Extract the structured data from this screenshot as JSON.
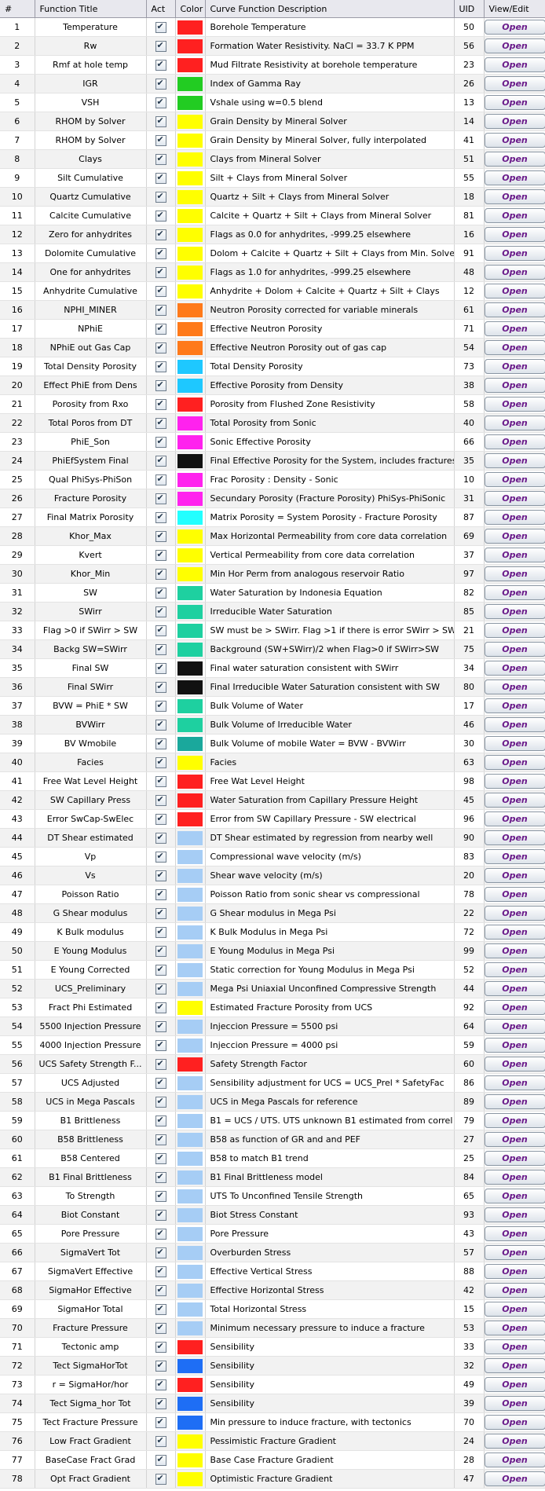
{
  "table": {
    "headers": {
      "num": "#",
      "title": "Function Title",
      "act": "Act",
      "color": "Color",
      "desc": "Curve Function Description",
      "uid": "UID",
      "view": "View/Edit"
    },
    "open_label": "Open",
    "rows": [
      {
        "num": "1",
        "title": "Temperature",
        "color": "#ff2020",
        "desc": "Borehole Temperature",
        "uid": "50"
      },
      {
        "num": "2",
        "title": "Rw",
        "color": "#ff2020",
        "desc": "Formation Water Resistivity. NaCl = 33.7 K PPM",
        "uid": "56"
      },
      {
        "num": "3",
        "title": "Rmf at hole temp",
        "color": "#ff2020",
        "desc": "Mud Filtrate Resistivity at borehole temperature",
        "uid": "23"
      },
      {
        "num": "4",
        "title": "IGR",
        "color": "#22cc22",
        "desc": "Index of Gamma Ray",
        "uid": "26"
      },
      {
        "num": "5",
        "title": "VSH",
        "color": "#22cc22",
        "desc": "Vshale using w=0.5 blend",
        "uid": "13"
      },
      {
        "num": "6",
        "title": "RHOM by Solver",
        "color": "#ffff00",
        "desc": "Grain Density by Mineral Solver",
        "uid": "14"
      },
      {
        "num": "7",
        "title": "RHOM by Solver",
        "color": "#ffff00",
        "desc": "Grain Density by Mineral Solver, fully interpolated",
        "uid": "41"
      },
      {
        "num": "8",
        "title": "Clays",
        "color": "#ffff00",
        "desc": "Clays from Mineral Solver",
        "uid": "51"
      },
      {
        "num": "9",
        "title": "Silt Cumulative",
        "color": "#ffff00",
        "desc": "Silt + Clays from Mineral Solver",
        "uid": "55"
      },
      {
        "num": "10",
        "title": "Quartz Cumulative",
        "color": "#ffff00",
        "desc": "Quartz + Silt + Clays from Mineral Solver",
        "uid": "18"
      },
      {
        "num": "11",
        "title": "Calcite Cumulative",
        "color": "#ffff00",
        "desc": "Calcite + Quartz + Silt + Clays from Mineral Solver",
        "uid": "81"
      },
      {
        "num": "12",
        "title": "Zero for anhydrites",
        "color": "#ffff00",
        "desc": "Flags as 0.0 for anhydrites, -999.25 elsewhere",
        "uid": "16"
      },
      {
        "num": "13",
        "title": "Dolomite Cumulative",
        "color": "#ffff00",
        "desc": "Dolom + Calcite + Quartz + Silt + Clays from Min. Solver",
        "uid": "91"
      },
      {
        "num": "14",
        "title": "One for anhydrites",
        "color": "#ffff00",
        "desc": "Flags as 1.0 for anhydrites, -999.25 elsewhere",
        "uid": "48"
      },
      {
        "num": "15",
        "title": "Anhydrite Cumulative",
        "color": "#ffff00",
        "desc": "Anhydrite + Dolom + Calcite + Quartz + Silt + Clays",
        "uid": "12"
      },
      {
        "num": "16",
        "title": "NPHI_MINER",
        "color": "#ff7a1a",
        "desc": "Neutron Porosity corrected for variable minerals",
        "uid": "61"
      },
      {
        "num": "17",
        "title": "NPhiE",
        "color": "#ff7a1a",
        "desc": "Effective Neutron Porosity",
        "uid": "71"
      },
      {
        "num": "18",
        "title": "NPhiE out Gas Cap",
        "color": "#ff7a1a",
        "desc": "Effective Neutron Porosity out of gas cap",
        "uid": "54"
      },
      {
        "num": "19",
        "title": "Total Density Porosity",
        "color": "#1ec8ff",
        "desc": "Total Density Porosity",
        "uid": "73"
      },
      {
        "num": "20",
        "title": "Effect PhiE from Dens",
        "color": "#1ec8ff",
        "desc": "Effective Porosity from Density",
        "uid": "38"
      },
      {
        "num": "21",
        "title": "Porosity from Rxo",
        "color": "#ff2020",
        "desc": "Porosity from Flushed Zone Resistivity",
        "uid": "58"
      },
      {
        "num": "22",
        "title": "Total Poros from DT",
        "color": "#ff22ee",
        "desc": "Total Porosity from Sonic",
        "uid": "40"
      },
      {
        "num": "23",
        "title": "PhiE_Son",
        "color": "#ff22ee",
        "desc": "Sonic Effective Porosity",
        "uid": "66"
      },
      {
        "num": "24",
        "title": "PhiEfSystem Final",
        "color": "#111111",
        "desc": "Final Effective Porosity for the System, includes fractures",
        "uid": "35"
      },
      {
        "num": "25",
        "title": "Qual PhiSys-PhiSon",
        "color": "#ff22ee",
        "desc": "Frac Porosity : Density - Sonic",
        "uid": "10"
      },
      {
        "num": "26",
        "title": "Fracture Porosity",
        "color": "#ff22ee",
        "desc": "Secundary Porosity (Fracture Porosity) PhiSys-PhiSonic",
        "uid": "31"
      },
      {
        "num": "27",
        "title": "Final Matrix Porosity",
        "color": "#22ffff",
        "desc": "Matrix Porosity = System Porosity - Fracture Porosity",
        "uid": "87"
      },
      {
        "num": "28",
        "title": "Khor_Max",
        "color": "#ffff00",
        "desc": "Max Horizontal Permeability from core data correlation",
        "uid": "69"
      },
      {
        "num": "29",
        "title": "Kvert",
        "color": "#ffff00",
        "desc": "Vertical Permeability from core data correlation",
        "uid": "37"
      },
      {
        "num": "30",
        "title": "Khor_Min",
        "color": "#ffff00",
        "desc": "Min Hor Perm from analogous reservoir Ratio",
        "uid": "97"
      },
      {
        "num": "31",
        "title": "SW",
        "color": "#1ed0a0",
        "desc": "Water Saturation by Indonesia Equation",
        "uid": "82"
      },
      {
        "num": "32",
        "title": "SWirr",
        "color": "#1ed0a0",
        "desc": "Irreducible Water Saturation",
        "uid": "85"
      },
      {
        "num": "33",
        "title": "Flag >0 if SWirr > SW",
        "color": "#1ed0a0",
        "desc": "SW must be > SWirr. Flag >1 if there is error SWirr > SW",
        "uid": "21"
      },
      {
        "num": "34",
        "title": "Backg SW=SWirr",
        "color": "#1ed0a0",
        "desc": "Background (SW+SWirr)/2 when Flag>0 if SWirr>SW",
        "uid": "75"
      },
      {
        "num": "35",
        "title": "Final SW",
        "color": "#111111",
        "desc": "Final water saturation consistent with SWirr",
        "uid": "34"
      },
      {
        "num": "36",
        "title": "Final SWirr",
        "color": "#111111",
        "desc": "Final Irreducible Water Saturation consistent with SW",
        "uid": "80"
      },
      {
        "num": "37",
        "title": "BVW = PhiE * SW",
        "color": "#1ed0a0",
        "desc": "Bulk Volume of Water",
        "uid": "17"
      },
      {
        "num": "38",
        "title": "BVWirr",
        "color": "#1ed0a0",
        "desc": "Bulk Volume of Irreducible Water",
        "uid": "46"
      },
      {
        "num": "39",
        "title": "BV Wmobile",
        "color": "#1aa89c",
        "desc": "Bulk Volume of mobile Water = BVW - BVWirr",
        "uid": "30"
      },
      {
        "num": "40",
        "title": "Facies",
        "color": "#ffff00",
        "desc": "Facies",
        "uid": "63"
      },
      {
        "num": "41",
        "title": "Free Wat Level Height",
        "color": "#ff2020",
        "desc": "Free Wat Level Height",
        "uid": "98"
      },
      {
        "num": "42",
        "title": "SW Capillary Press",
        "color": "#ff2020",
        "desc": "Water Saturation from Capillary Pressure Height",
        "uid": "45"
      },
      {
        "num": "43",
        "title": "Error SwCap-SwElec",
        "color": "#ff2020",
        "desc": "Error from SW Capillary Pressure - SW electrical",
        "uid": "96"
      },
      {
        "num": "44",
        "title": "DT Shear estimated",
        "color": "#a6cdf5",
        "desc": "DT Shear estimated by regression from nearby well",
        "uid": "90"
      },
      {
        "num": "45",
        "title": "Vp",
        "color": "#a6cdf5",
        "desc": "Compressional wave velocity (m/s)",
        "uid": "83"
      },
      {
        "num": "46",
        "title": "Vs",
        "color": "#a6cdf5",
        "desc": "Shear wave velocity (m/s)",
        "uid": "20"
      },
      {
        "num": "47",
        "title": "Poisson Ratio",
        "color": "#a6cdf5",
        "desc": "Poisson Ratio from sonic shear vs compressional",
        "uid": "78"
      },
      {
        "num": "48",
        "title": "G Shear modulus",
        "color": "#a6cdf5",
        "desc": "G Shear modulus in Mega Psi",
        "uid": "22"
      },
      {
        "num": "49",
        "title": "K Bulk modulus",
        "color": "#a6cdf5",
        "desc": "K Bulk Modulus in Mega Psi",
        "uid": "72"
      },
      {
        "num": "50",
        "title": "E Young Modulus",
        "color": "#a6cdf5",
        "desc": "E Young Modulus in Mega Psi",
        "uid": "99"
      },
      {
        "num": "51",
        "title": "E Young Corrected",
        "color": "#a6cdf5",
        "desc": "Static correction for Young Modulus in Mega Psi",
        "uid": "52"
      },
      {
        "num": "52",
        "title": "UCS_Preliminary",
        "color": "#a6cdf5",
        "desc": "Mega Psi Uniaxial Unconfined Compressive Strength",
        "uid": "44"
      },
      {
        "num": "53",
        "title": "Fract Phi Estimated",
        "color": "#ffff00",
        "desc": "Estimated Fracture Porosity from UCS",
        "uid": "92"
      },
      {
        "num": "54",
        "title": "5500 Injection Pressure",
        "color": "#a6cdf5",
        "desc": "Injeccion Pressure = 5500 psi",
        "uid": "64"
      },
      {
        "num": "55",
        "title": "4000 Injection Pressure",
        "color": "#a6cdf5",
        "desc": "Injeccion Pressure = 4000 psi",
        "uid": "59"
      },
      {
        "num": "56",
        "title": "UCS Safety Strength F...",
        "color": "#ff2020",
        "desc": "Safety Strength Factor",
        "uid": "60"
      },
      {
        "num": "57",
        "title": "UCS Adjusted",
        "color": "#a6cdf5",
        "desc": "Sensibility adjustment for UCS = UCS_Prel * SafetyFac",
        "uid": "86"
      },
      {
        "num": "58",
        "title": "UCS in Mega Pascals",
        "color": "#a6cdf5",
        "desc": "UCS in Mega Pascals for reference",
        "uid": "89"
      },
      {
        "num": "59",
        "title": "B1 Brittleness",
        "color": "#a6cdf5",
        "desc": "B1 = UCS / UTS. UTS unknown B1 estimated from correl",
        "uid": "79"
      },
      {
        "num": "60",
        "title": "B58 Brittleness",
        "color": "#a6cdf5",
        "desc": "B58 as function of GR and  and PEF",
        "uid": "27"
      },
      {
        "num": "61",
        "title": "B58 Centered",
        "color": "#a6cdf5",
        "desc": "B58 to match B1 trend",
        "uid": "25"
      },
      {
        "num": "62",
        "title": "B1 Final Brittleness",
        "color": "#a6cdf5",
        "desc": "B1 Final Brittleness model",
        "uid": "84"
      },
      {
        "num": "63",
        "title": "To Strength",
        "color": "#a6cdf5",
        "desc": "UTS To Unconfined Tensile Strength",
        "uid": "65"
      },
      {
        "num": "64",
        "title": "Biot Constant",
        "color": "#a6cdf5",
        "desc": "Biot Stress Constant",
        "uid": "93"
      },
      {
        "num": "65",
        "title": "Pore Pressure",
        "color": "#a6cdf5",
        "desc": "Pore Pressure",
        "uid": "43"
      },
      {
        "num": "66",
        "title": "SigmaVert Tot",
        "color": "#a6cdf5",
        "desc": "Overburden Stress",
        "uid": "57"
      },
      {
        "num": "67",
        "title": "SigmaVert Effective",
        "color": "#a6cdf5",
        "desc": "Effective Vertical Stress",
        "uid": "88"
      },
      {
        "num": "68",
        "title": "SigmaHor Effective",
        "color": "#a6cdf5",
        "desc": "Effective Horizontal Stress",
        "uid": "42"
      },
      {
        "num": "69",
        "title": "SigmaHor Total",
        "color": "#a6cdf5",
        "desc": "Total Horizontal Stress",
        "uid": "15"
      },
      {
        "num": "70",
        "title": "Fracture Pressure",
        "color": "#a6cdf5",
        "desc": "Minimum necessary pressure to induce a fracture",
        "uid": "53"
      },
      {
        "num": "71",
        "title": "Tectonic amp",
        "color": "#ff2020",
        "desc": "Sensibility",
        "uid": "33"
      },
      {
        "num": "72",
        "title": "Tect SigmaHorTot",
        "color": "#1e6ef5",
        "desc": "Sensibility",
        "uid": "32"
      },
      {
        "num": "73",
        "title": "r = SigmaHor/hor",
        "color": "#ff2020",
        "desc": "Sensibility",
        "uid": "49"
      },
      {
        "num": "74",
        "title": "Tect Sigma_hor Tot",
        "color": "#1e6ef5",
        "desc": "Sensibility",
        "uid": "39"
      },
      {
        "num": "75",
        "title": "Tect Fracture Pressure",
        "color": "#1e6ef5",
        "desc": "Min pressure to induce fracture, with tectonics",
        "uid": "70"
      },
      {
        "num": "76",
        "title": "Low Fract Gradient",
        "color": "#ffff00",
        "desc": "Pessimistic Fracture Gradient",
        "uid": "24"
      },
      {
        "num": "77",
        "title": "BaseCase Fract Grad",
        "color": "#ffff00",
        "desc": "Base Case Fracture Gradient",
        "uid": "28"
      },
      {
        "num": "78",
        "title": "Opt Fract Gradient",
        "color": "#ffff00",
        "desc": "Optimistic Fracture Gradient",
        "uid": "47"
      }
    ]
  }
}
